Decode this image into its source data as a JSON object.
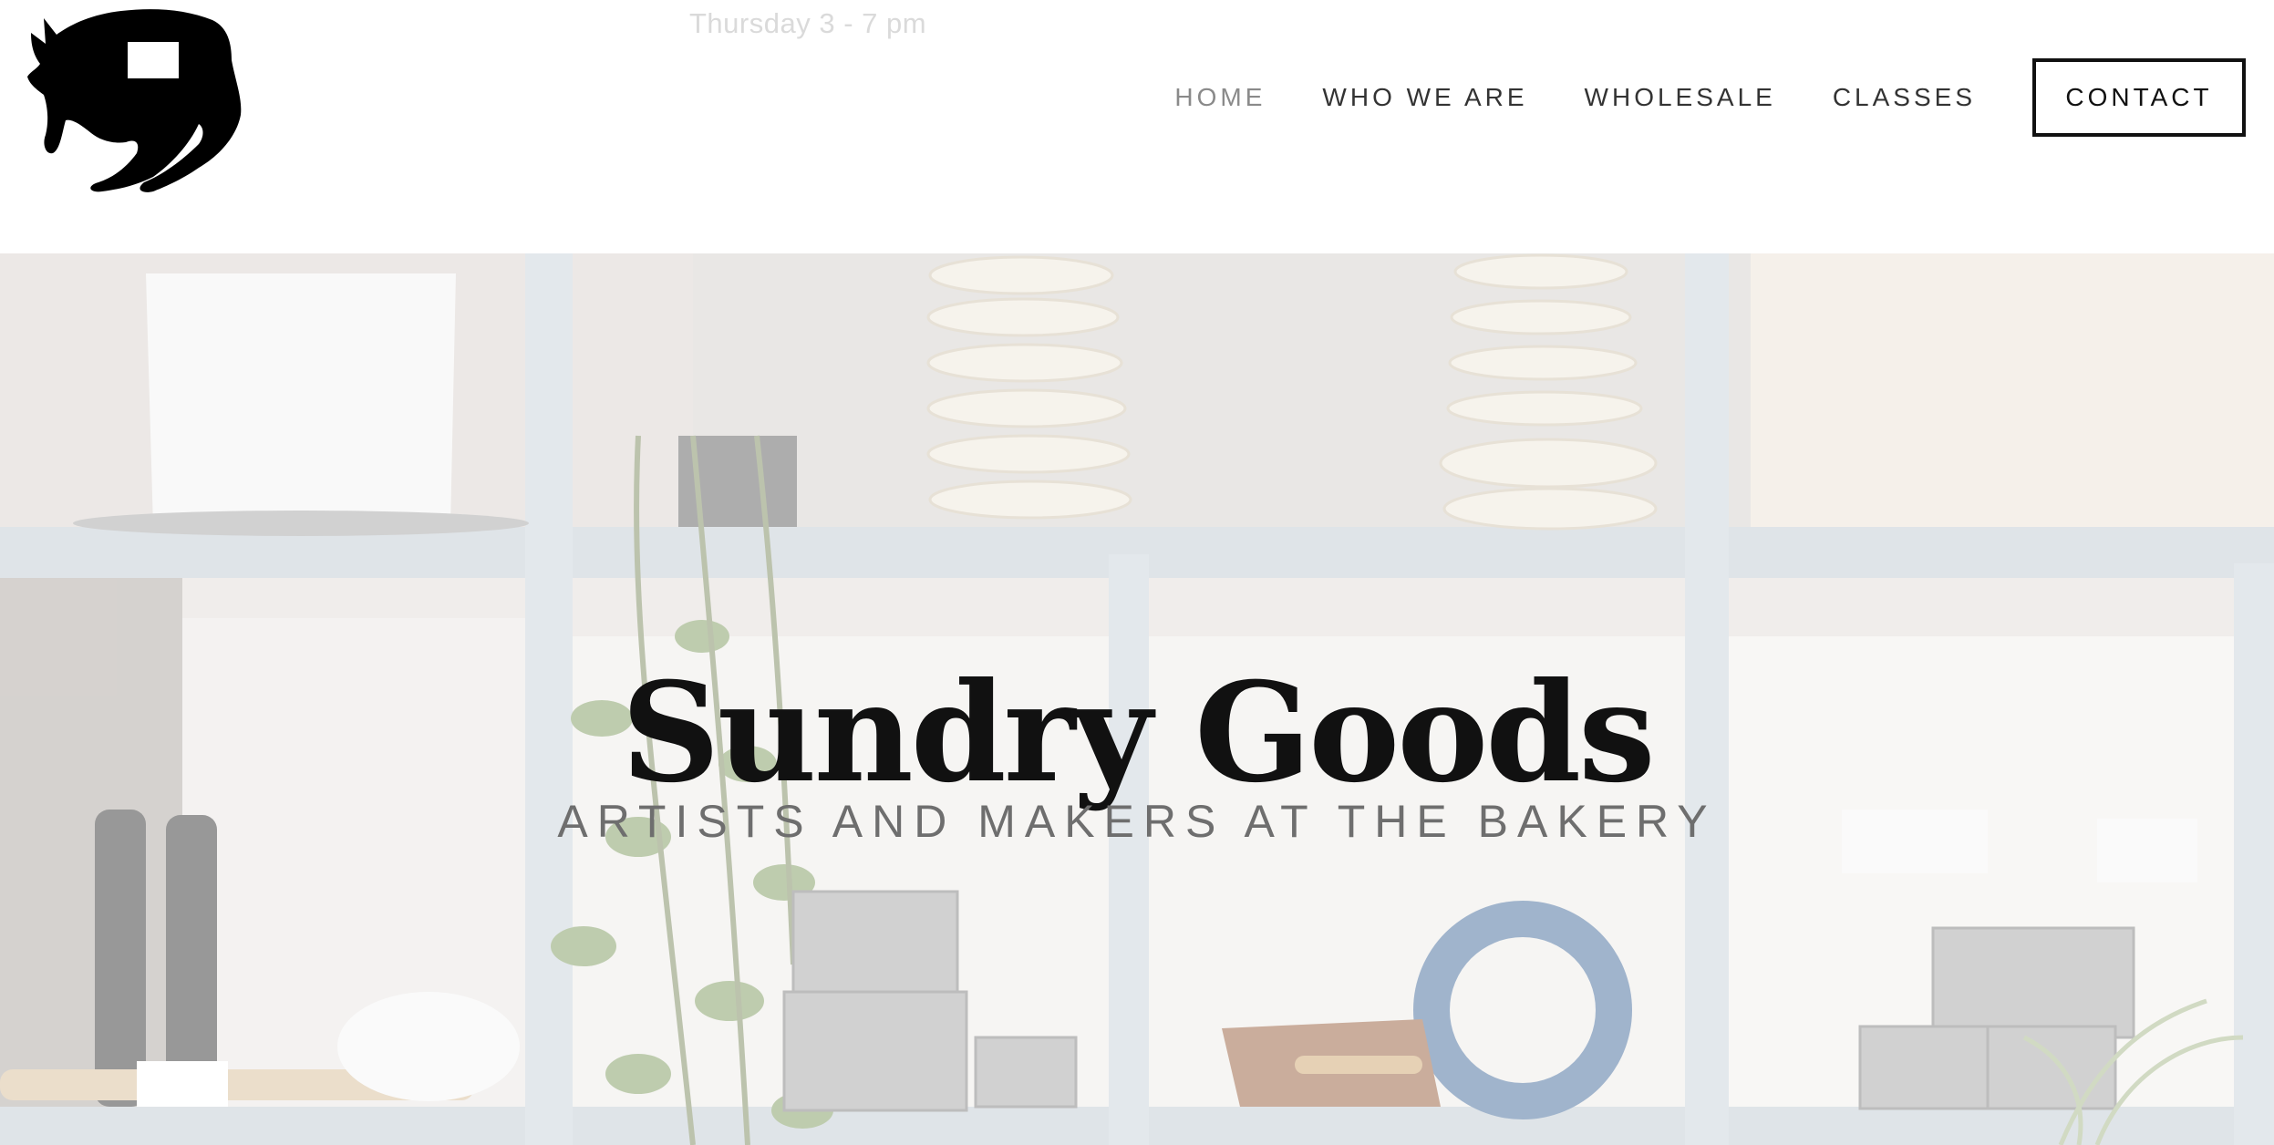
{
  "header": {
    "logo_icon": "coyote-logo-icon",
    "hours_text": "Thursday 3 - 7 pm",
    "nav": [
      {
        "label": "HOME",
        "active": true
      },
      {
        "label": "WHO WE ARE",
        "active": false
      },
      {
        "label": "WHOLESALE",
        "active": false
      },
      {
        "label": "CLASSES",
        "active": false
      }
    ],
    "contact_label": "CONTACT"
  },
  "hero": {
    "title": "Sundry Goods",
    "subtitle": "ARTISTS AND MAKERS AT THE BAKERY",
    "background": "bakery-shelves-photo"
  },
  "colors": {
    "nav_text": "#333333",
    "nav_active": "#8a8a8a",
    "contact_border": "#111111",
    "title": "#111111",
    "subtitle": "#6e6e6e"
  }
}
